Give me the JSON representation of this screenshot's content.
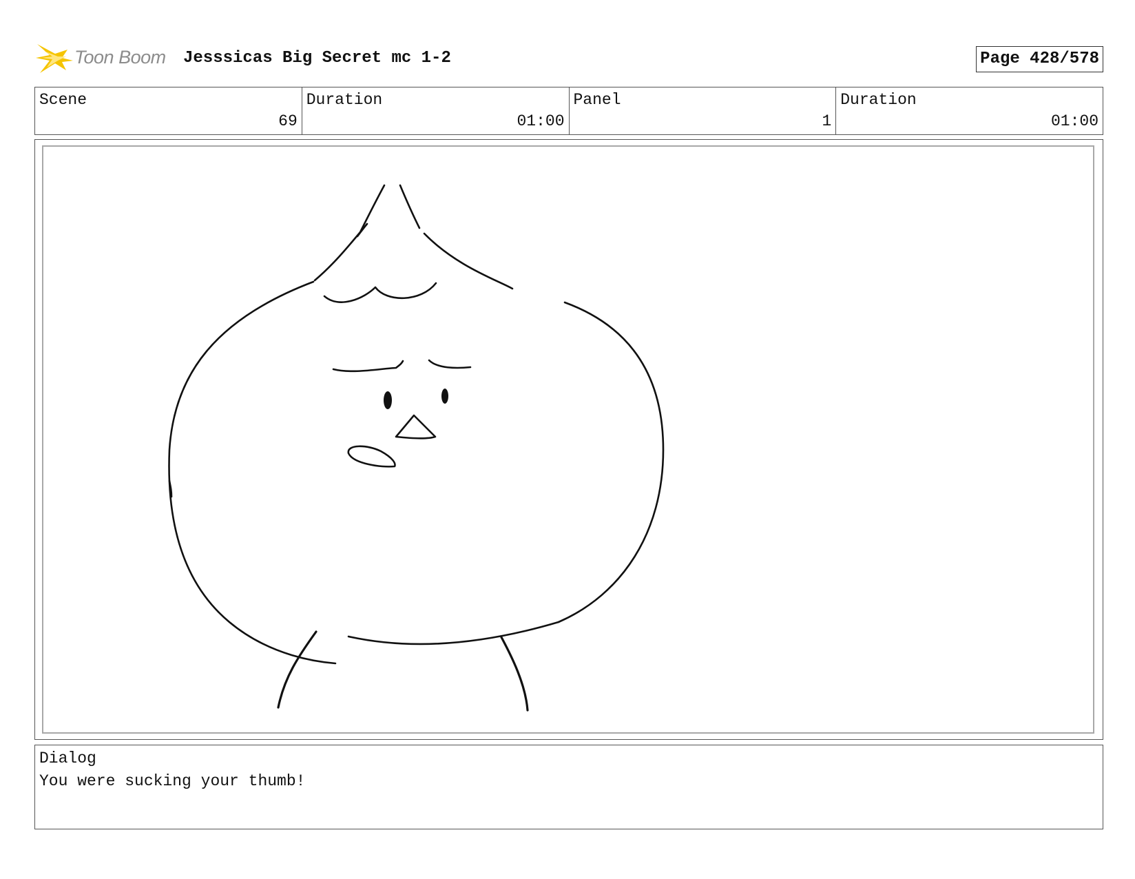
{
  "header": {
    "logo_text": "Toon Boom",
    "project_title": "Jesssicas Big Secret mc 1-2",
    "page_label": "Page 428/578"
  },
  "info": {
    "scene_label": "Scene",
    "scene_value": "69",
    "scene_duration_label": "Duration",
    "scene_duration_value": "01:00",
    "panel_label": "Panel",
    "panel_value": "1",
    "panel_duration_label": "Duration",
    "panel_duration_value": "01:00"
  },
  "dialog": {
    "label": "Dialog",
    "text": "You were sucking your thumb!"
  },
  "colors": {
    "logo_burst": "#f5c400",
    "logo_text": "#8c8c8c",
    "sketch_line": "#111111"
  }
}
